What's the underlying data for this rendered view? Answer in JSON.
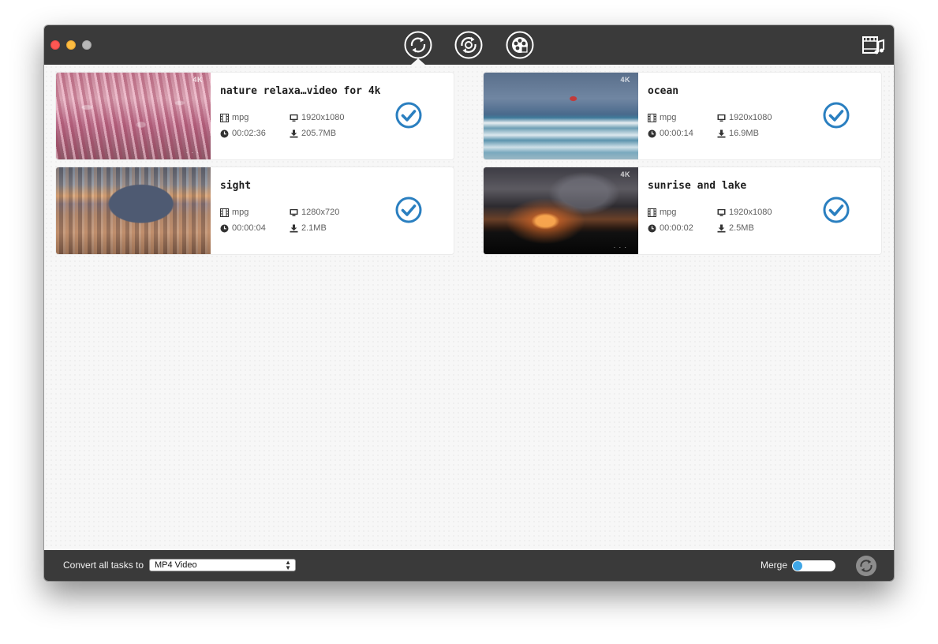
{
  "toolbar": {
    "tabs": [
      {
        "name": "convert",
        "icon": "convert-icon",
        "active": true
      },
      {
        "name": "edit",
        "icon": "edit-convert-icon",
        "active": false
      },
      {
        "name": "toolbox",
        "icon": "film-reel-icon",
        "active": false
      }
    ],
    "media_library_icon": "media-library-icon"
  },
  "tasks": [
    {
      "title": "nature relaxa…video for 4k",
      "format": "mpg",
      "resolution": "1920x1080",
      "duration": "00:02:36",
      "size": "205.7MB",
      "badge": "4K",
      "checked": true
    },
    {
      "title": "ocean",
      "format": "mpg",
      "resolution": "1920x1080",
      "duration": "00:00:14",
      "size": "16.9MB",
      "badge": "4K",
      "checked": true
    },
    {
      "title": "sight",
      "format": "mpg",
      "resolution": "1280x720",
      "duration": "00:00:04",
      "size": "2.1MB",
      "badge": "",
      "checked": true
    },
    {
      "title": "sunrise and lake",
      "format": "mpg",
      "resolution": "1920x1080",
      "duration": "00:00:02",
      "size": "2.5MB",
      "badge": "4K",
      "checked": true
    }
  ],
  "footer": {
    "convert_label": "Convert all tasks to",
    "format_value": "MP4 Video",
    "merge_label": "Merge",
    "merge_on": false
  },
  "colors": {
    "accent": "#2a7fc0",
    "bar": "#3a3a3a",
    "toggle_knob": "#3fa6e6"
  }
}
